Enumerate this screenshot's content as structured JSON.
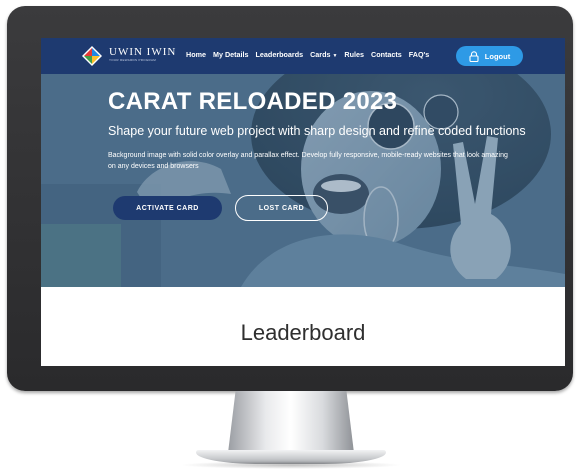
{
  "brand": {
    "name": "UWIN IWIN",
    "tagline": "YOUR REWARDS PROGRAM"
  },
  "nav": {
    "items": [
      {
        "label": "Home"
      },
      {
        "label": "My Details"
      },
      {
        "label": "Leaderboards"
      },
      {
        "label": "Cards"
      },
      {
        "label": "Rules"
      },
      {
        "label": "Contacts"
      },
      {
        "label": "FAQ's"
      }
    ],
    "logout_label": "Logout"
  },
  "hero": {
    "title": "CARAT RELOADED 2023",
    "subtitle": "Shape your future web project with sharp design and refine coded functions",
    "description": "Background image with solid color overlay and parallax effect. Develop fully responsive, mobile-ready websites that look amazing on any devices and browsers",
    "activate_label": "ACTIVATE CARD",
    "lost_label": "LOST CARD"
  },
  "section": {
    "title": "Leaderboard"
  },
  "colors": {
    "navbar": "#1e3a70",
    "accent": "#2e9ae6",
    "bezel": "#2f2f31"
  }
}
